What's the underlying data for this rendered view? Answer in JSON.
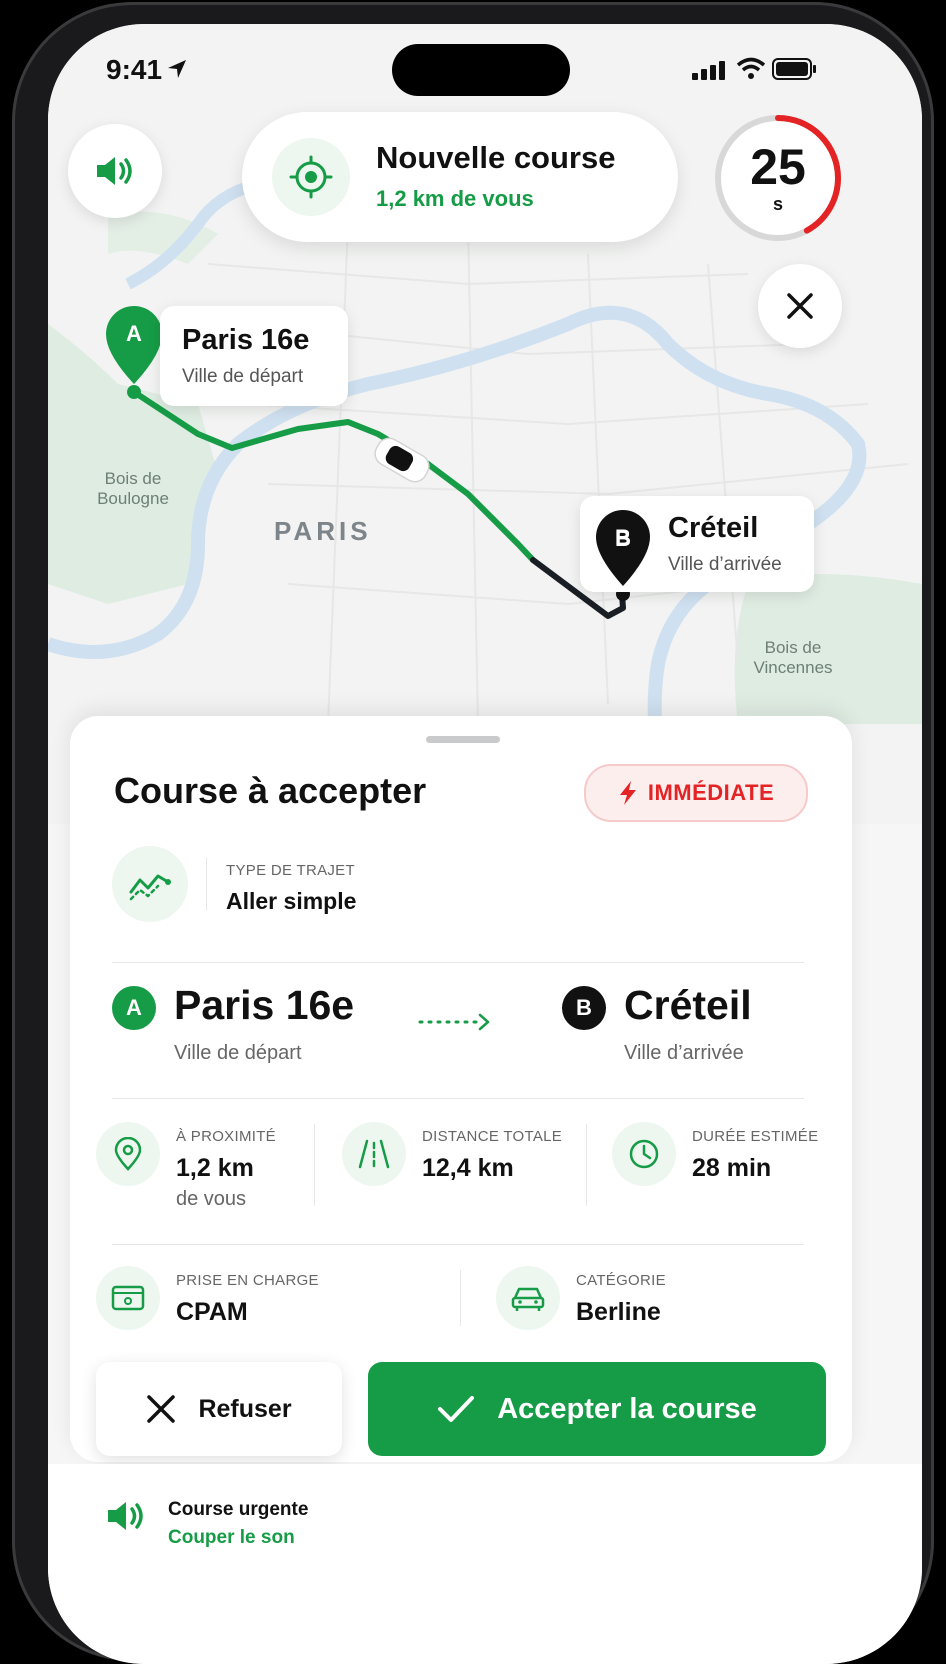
{
  "status_bar": {
    "time": "9:41"
  },
  "header": {
    "title": "Nouvelle course",
    "distance": "1,2 km de vous",
    "timer_value": "25",
    "timer_unit": "s",
    "timer_progress": 0.42
  },
  "map": {
    "start": {
      "letter": "A",
      "city": "Paris 16e",
      "role": "Ville de départ"
    },
    "end": {
      "letter": "B",
      "city": "Créteil",
      "role": "Ville d’arrivée"
    },
    "labels": {
      "bois_boulogne": "Bois de Boulogne",
      "paris": "PARIS",
      "bois_vincennes": "Bois de Vincennes"
    }
  },
  "sheet": {
    "title": "Course à accepter",
    "badge": "IMMÉDIATE",
    "trip_type_label": "TYPE DE TRAJET",
    "trip_type_value": "Aller simple",
    "from": {
      "letter": "A",
      "city": "Paris 16e",
      "role": "Ville de départ"
    },
    "to": {
      "letter": "B",
      "city": "Créteil",
      "role": "Ville d’arrivée"
    },
    "stats": {
      "proximity": {
        "label": "À PROXIMITÉ",
        "value": "1,2 km",
        "sub": "de vous"
      },
      "distance": {
        "label": "DISTANCE TOTALE",
        "value": "12,4 km"
      },
      "duration": {
        "label": "DURÉE ESTIMÉE",
        "value": "28 min"
      }
    },
    "pickup": {
      "label": "PRISE EN CHARGE",
      "value": "CPAM"
    },
    "category": {
      "label": "CATÉGORIE",
      "value": "Berline"
    },
    "refuse_label": "Refuser",
    "accept_label": "Accepter la course"
  },
  "bottom": {
    "title": "Course urgente",
    "action": "Couper le son"
  },
  "colors": {
    "accent": "#169c46",
    "danger": "#e42325",
    "dark": "#111111"
  }
}
